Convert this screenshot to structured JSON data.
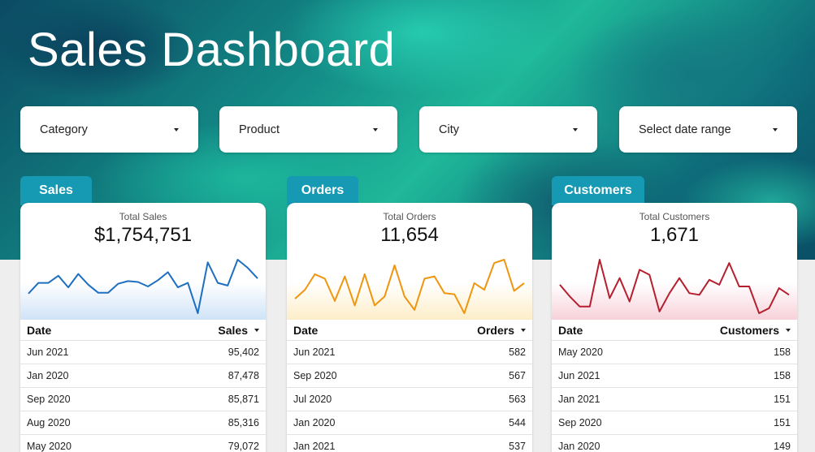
{
  "header": {
    "title": "Sales Dashboard"
  },
  "filters": [
    {
      "label": "Category"
    },
    {
      "label": "Product"
    },
    {
      "label": "City"
    },
    {
      "label": "Select date range"
    }
  ],
  "panels": [
    {
      "tab": "Sales",
      "kpi_label": "Total Sales",
      "kpi_value": "$1,754,751",
      "color": "#1f6fc0",
      "fill": "#cfe3f7",
      "date_header": "Date",
      "metric_header": "Sales",
      "rows": [
        {
          "date": "Jun 2021",
          "value": "95,402"
        },
        {
          "date": "Jan 2020",
          "value": "87,478"
        },
        {
          "date": "Sep 2020",
          "value": "85,871"
        },
        {
          "date": "Aug 2020",
          "value": "85,316"
        },
        {
          "date": "May 2020",
          "value": "79,072"
        }
      ]
    },
    {
      "tab": "Orders",
      "kpi_label": "Total Orders",
      "kpi_value": "11,654",
      "color": "#f0950f",
      "fill": "#fdeec8",
      "date_header": "Date",
      "metric_header": "Orders",
      "rows": [
        {
          "date": "Jun 2021",
          "value": "582"
        },
        {
          "date": "Sep 2020",
          "value": "567"
        },
        {
          "date": "Jul 2020",
          "value": "563"
        },
        {
          "date": "Jan 2020",
          "value": "544"
        },
        {
          "date": "Jan 2021",
          "value": "537"
        }
      ]
    },
    {
      "tab": "Customers",
      "kpi_label": "Total Customers",
      "kpi_value": "1,671",
      "color": "#b51f2e",
      "fill": "#f7d2da",
      "date_header": "Date",
      "metric_header": "Customers",
      "rows": [
        {
          "date": "May 2020",
          "value": "158"
        },
        {
          "date": "Jun 2021",
          "value": "158"
        },
        {
          "date": "Jan 2021",
          "value": "151"
        },
        {
          "date": "Sep 2020",
          "value": "151"
        },
        {
          "date": "Jan 2020",
          "value": "149"
        }
      ]
    }
  ],
  "chart_data": [
    {
      "type": "line",
      "series": [
        {
          "values": [
            35,
            47,
            47,
            55,
            42,
            57,
            45,
            36,
            36,
            46,
            49,
            48,
            43,
            50,
            59,
            42,
            47,
            13,
            70,
            47,
            44,
            73,
            64,
            52
          ]
        }
      ]
    },
    {
      "type": "line",
      "series": [
        {
          "values": [
            50,
            58,
            72,
            68,
            48,
            70,
            44,
            72,
            44,
            52,
            80,
            52,
            40,
            68,
            70,
            55,
            54,
            37,
            64,
            58,
            82,
            85,
            57,
            64
          ]
        }
      ]
    },
    {
      "type": "line",
      "series": [
        {
          "values": [
            120,
            113,
            107,
            107,
            135,
            112,
            124,
            110,
            129,
            126,
            104,
            115,
            124,
            115,
            114,
            123,
            120,
            133,
            119,
            119,
            103,
            106,
            118,
            114
          ]
        }
      ]
    }
  ]
}
